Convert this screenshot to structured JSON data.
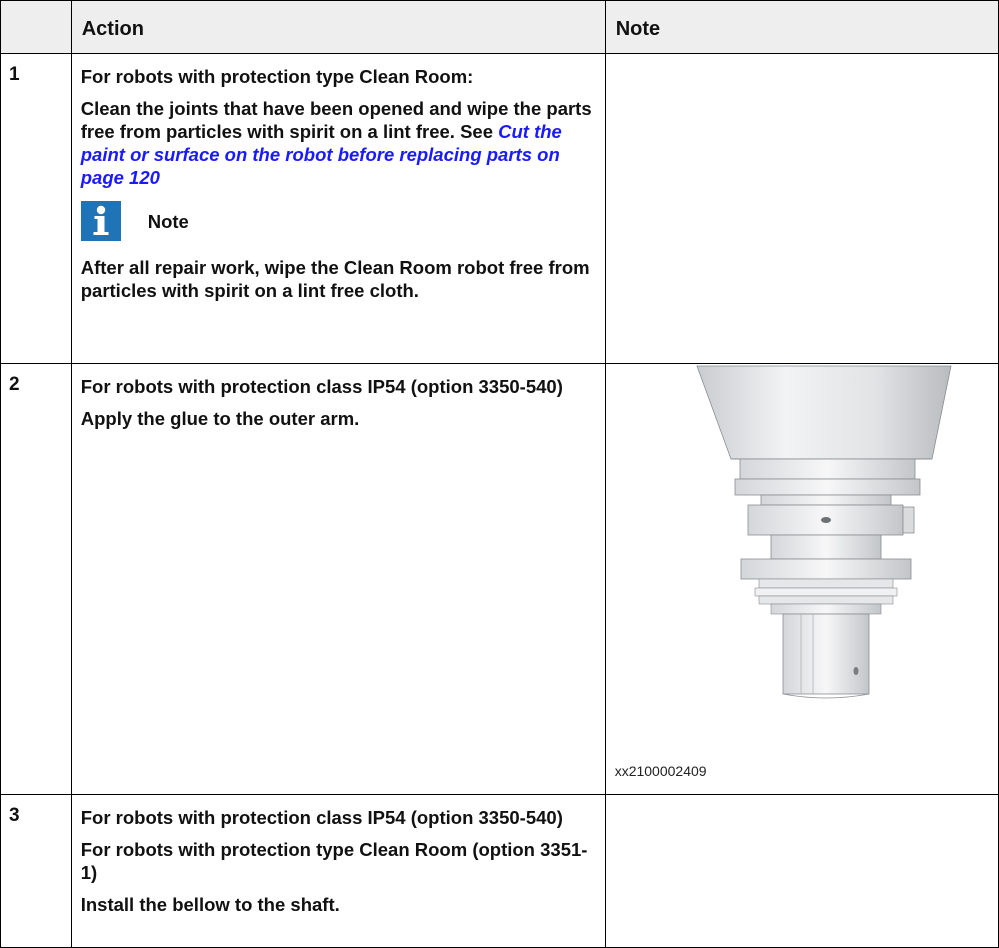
{
  "table": {
    "headers": [
      "",
      "Action",
      "Note"
    ],
    "rows": [
      {
        "step": "1",
        "action": [
          "For robots with protection type Clean Room:",
          "Clean the joints that have been opened and wipe the parts free from particles with spirit on a lint free. See"
        ],
        "link": "Cut the paint or surface on the robot before replacing parts on page 120",
        "admonition": {
          "icon": "info-icon",
          "label": "Note",
          "text": "After all repair work, wipe the Clean Room robot free from particles with spirit on a lint free cloth."
        },
        "note": ""
      },
      {
        "step": "2",
        "action": [
          "For robots with protection class IP54 (option 3350-540)",
          "Apply the glue to the outer arm."
        ],
        "note_image": {
          "icon": "robot-shaft-illustration",
          "caption": "xx2100002409"
        }
      },
      {
        "step": "3",
        "action": [
          "For robots with protection class IP54 (option 3350-540)",
          "For robots with protection type Clean Room (option 3351-1)",
          "Install the bellow to the shaft."
        ],
        "note": ""
      }
    ]
  },
  "colors": {
    "header_bg": "#eeeeee",
    "link": "#1a1aff",
    "icon_bg": "#1f73b7"
  }
}
